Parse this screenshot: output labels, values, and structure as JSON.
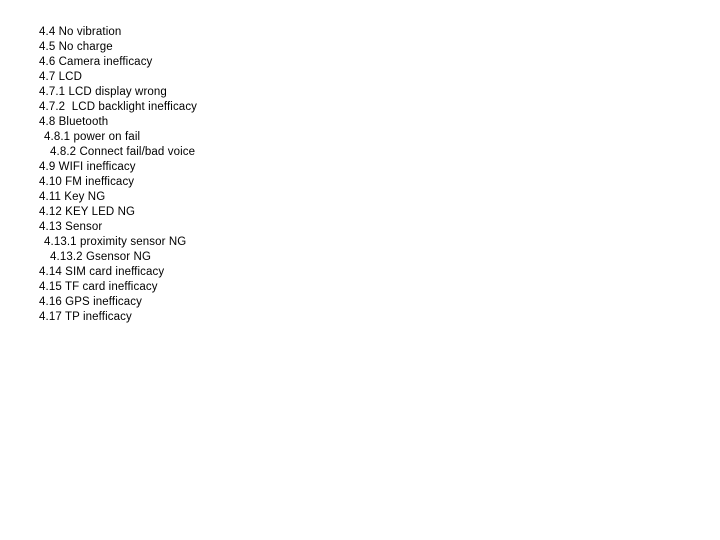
{
  "document": {
    "background_color": "#ffffff",
    "text_color": "#000000",
    "outline": {
      "items": [
        {
          "text": "4.4 No vibration",
          "indent": 0
        },
        {
          "text": "4.5 No charge",
          "indent": 0
        },
        {
          "text": "4.6 Camera inefficacy",
          "indent": 0
        },
        {
          "text": "4.7 LCD",
          "indent": 0
        },
        {
          "text": "4.7.1 LCD display wrong",
          "indent": 0
        },
        {
          "text": "4.7.2  LCD backlight inefficacy",
          "indent": 0
        },
        {
          "text": "4.8 Bluetooth",
          "indent": 0
        },
        {
          "text": "4.8.1 power on fail",
          "indent": 1
        },
        {
          "text": "4.8.2 Connect fail/bad voice",
          "indent": 2
        },
        {
          "text": "4.9 WIFI inefficacy",
          "indent": 0
        },
        {
          "text": "4.10 FM inefficacy",
          "indent": 0
        },
        {
          "text": "4.11 Key NG",
          "indent": 0
        },
        {
          "text": "4.12 KEY LED NG",
          "indent": 0
        },
        {
          "text": "4.13 Sensor",
          "indent": 0
        },
        {
          "text": "4.13.1 proximity sensor NG",
          "indent": 1
        },
        {
          "text": "4.13.2 Gsensor NG",
          "indent": 2
        },
        {
          "text": "4.14 SIM card inefficacy",
          "indent": 0
        },
        {
          "text": "4.15 TF card inefficacy",
          "indent": 0
        },
        {
          "text": "4.16 GPS inefficacy",
          "indent": 0
        },
        {
          "text": "4.17 TP inefficacy",
          "indent": 0
        }
      ]
    }
  }
}
